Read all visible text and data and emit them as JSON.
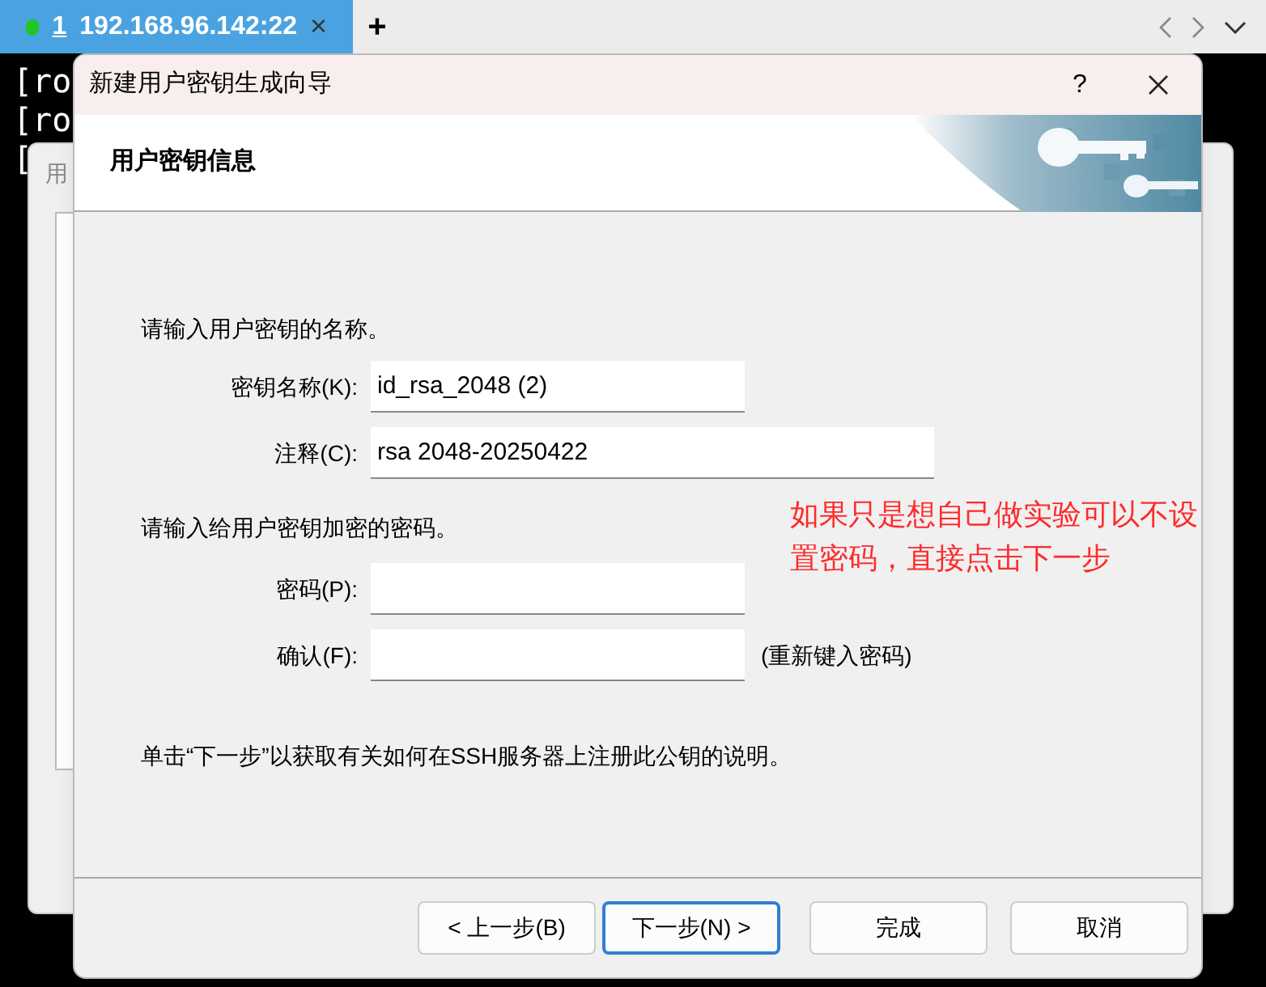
{
  "tab_bar": {
    "tabs": [
      {
        "number": "1",
        "label": "192.168.96.142:22",
        "selected": true,
        "connected": true
      }
    ],
    "add_label": "+",
    "close_label": "×"
  },
  "terminal": {
    "lines": [
      "[ro",
      "[ro",
      "["
    ]
  },
  "back_dialog": {
    "title": "用"
  },
  "dialog": {
    "title": "新建用户密钥生成向导",
    "help_label": "?",
    "header": "用户密钥信息",
    "name_prompt": "请输入用户密钥的名称。",
    "fields": [
      {
        "label": "密钥名称(K):",
        "value": "id_rsa_2048 (2)",
        "wide": false
      },
      {
        "label": "注释(C):",
        "value": "rsa 2048-20250422",
        "wide": true
      }
    ],
    "password_prompt": "请输入给用户密钥加密的密码。",
    "password_fields": [
      {
        "label": "密码(P):"
      },
      {
        "label": "确认(F):",
        "hint": "(重新键入密码)"
      }
    ],
    "note": "单击“下一步”以获取有关如何在SSH服务器上注册此公钥的说明。",
    "annotation": "如果只是想自己做实验可以不设置密码，直接点击下一步",
    "buttons": [
      {
        "label": "< 上一步(B)",
        "focused": false
      },
      {
        "label": "下一步(N) >",
        "focused": true
      },
      {
        "label": "完成",
        "focused": false
      },
      {
        "label": "取消",
        "focused": false
      }
    ]
  }
}
